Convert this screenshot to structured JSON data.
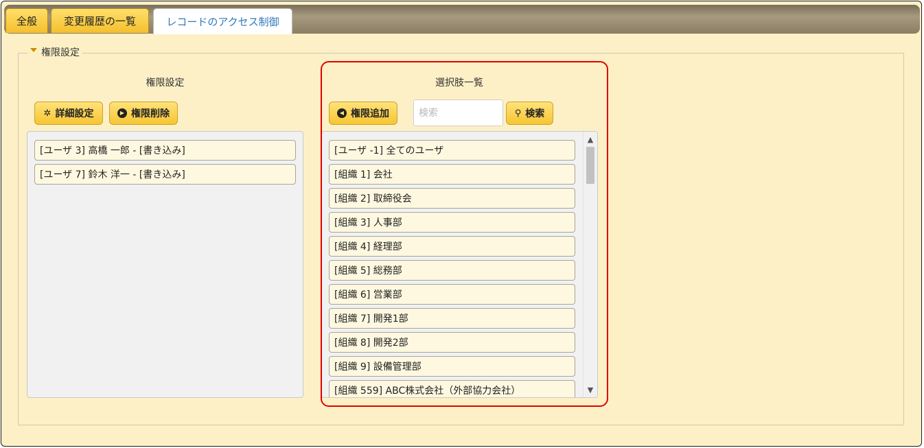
{
  "tabs": [
    {
      "label": "全般"
    },
    {
      "label": "変更履歴の一覧"
    },
    {
      "label": "レコードのアクセス制御"
    }
  ],
  "section": {
    "legend": "権限設定"
  },
  "left": {
    "title": "権限設定",
    "detail_button": "詳細設定",
    "delete_button": "権限削除",
    "items": [
      {
        "label": "[ユーザ 3] 高橋 一郎 - [書き込み]"
      },
      {
        "label": "[ユーザ 7] 鈴木 洋一 - [書き込み]"
      }
    ]
  },
  "right": {
    "title": "選択肢一覧",
    "add_button": "権限追加",
    "search_placeholder": "検索",
    "search_button": "検索",
    "items": [
      {
        "label": "[ユーザ -1] 全てのユーザ"
      },
      {
        "label": "[組織 1] 会社"
      },
      {
        "label": "[組織 2] 取締役会"
      },
      {
        "label": "[組織 3] 人事部"
      },
      {
        "label": "[組織 4] 経理部"
      },
      {
        "label": "[組織 5] 総務部"
      },
      {
        "label": "[組織 6] 営業部"
      },
      {
        "label": "[組織 7] 開発1部"
      },
      {
        "label": "[組織 8] 開発2部"
      },
      {
        "label": "[組織 9] 設備管理部"
      },
      {
        "label": "[組織 559] ABC株式会社（外部協力会社）"
      }
    ]
  },
  "colors": {
    "tab_bg": "#f4bf2d",
    "active_tab_text": "#2f79b8",
    "highlight": "#e00000",
    "panel_bg": "#fdf0c6"
  }
}
